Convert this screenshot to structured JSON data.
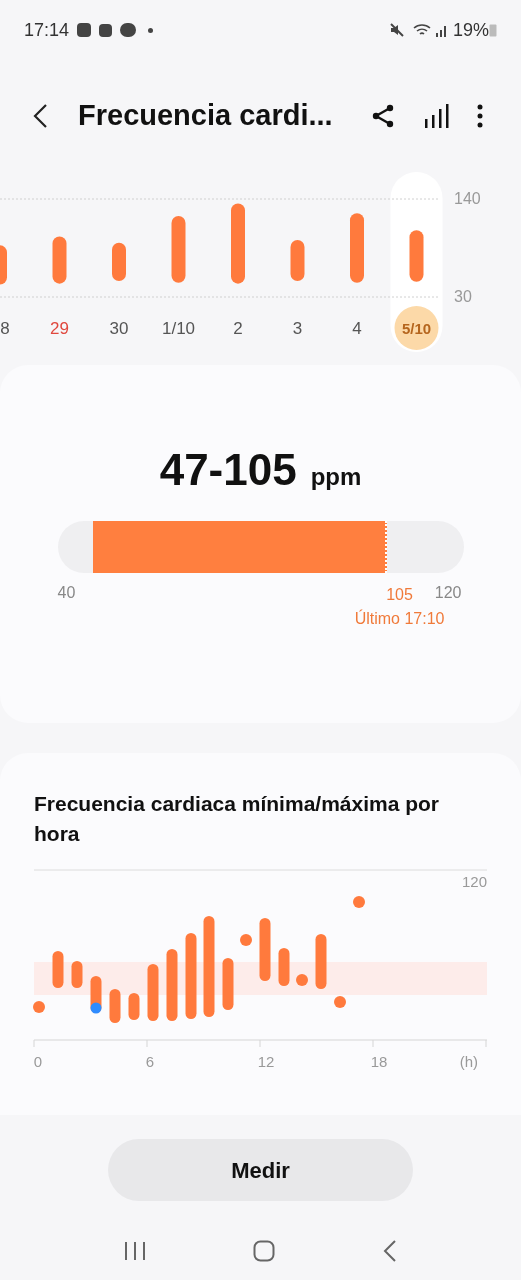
{
  "status_bar": {
    "time": "17:14",
    "battery": "19%"
  },
  "header": {
    "title": "Frecuencia cardi..."
  },
  "daily_chart": {
    "yticks": [
      "140",
      "30"
    ],
    "days": [
      {
        "label": "8",
        "selected": false,
        "color": "#555555"
      },
      {
        "label": "29",
        "selected": false,
        "color": "#e0483e"
      },
      {
        "label": "30",
        "selected": false,
        "color": "#555555"
      },
      {
        "label": "1/10",
        "selected": false,
        "color": "#555555"
      },
      {
        "label": "2",
        "selected": false,
        "color": "#555555"
      },
      {
        "label": "3",
        "selected": false,
        "color": "#555555"
      },
      {
        "label": "4",
        "selected": false,
        "color": "#555555"
      },
      {
        "label": "5/10",
        "selected": true,
        "color": "#b5651d"
      }
    ]
  },
  "summary": {
    "range": "47-105",
    "unit": "ppm",
    "scale_min": "40",
    "scale_max": "120",
    "last_value": "105",
    "last_time": "Último 17:10"
  },
  "hourly": {
    "title": "Frecuencia cardiaca mínima/máxima por hora",
    "ytick": "120",
    "xticks": [
      "0",
      "6",
      "12",
      "18",
      "(h)"
    ]
  },
  "button": "Medir"
}
